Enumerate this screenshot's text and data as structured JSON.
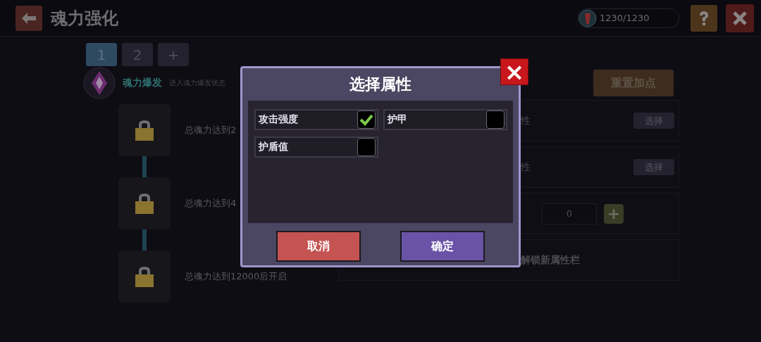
{
  "header": {
    "title": "魂力强化",
    "currency": "1230/1230"
  },
  "tabs": [
    {
      "label": "1",
      "selected": true
    },
    {
      "label": "2",
      "selected": false
    },
    {
      "label": "+",
      "selected": false
    }
  ],
  "burst": {
    "name": "魂力爆发",
    "description": "进入魂力爆发状态"
  },
  "unlock_steps": [
    {
      "text": "总魂力达到2"
    },
    {
      "text": "总魂力达到4"
    },
    {
      "text": "总魂力达到12000后开启"
    }
  ],
  "reset_button": "重置加点",
  "attribute_rows": [
    {
      "kind": "select",
      "label": "性",
      "button": "选择"
    },
    {
      "kind": "select",
      "label": "性",
      "button": "选择"
    },
    {
      "kind": "points",
      "value": "0",
      "button": "+"
    },
    {
      "kind": "unlock",
      "label": "解锁新属性栏"
    }
  ],
  "dialog": {
    "title": "选择属性",
    "close": "×",
    "options": [
      {
        "label": "攻击强度",
        "checked": true
      },
      {
        "label": "护甲",
        "checked": false
      },
      {
        "label": "护盾值",
        "checked": false
      }
    ],
    "buttons": [
      {
        "kind": "cancel",
        "label": "取消"
      },
      {
        "kind": "confirm",
        "label": "确定"
      }
    ]
  }
}
